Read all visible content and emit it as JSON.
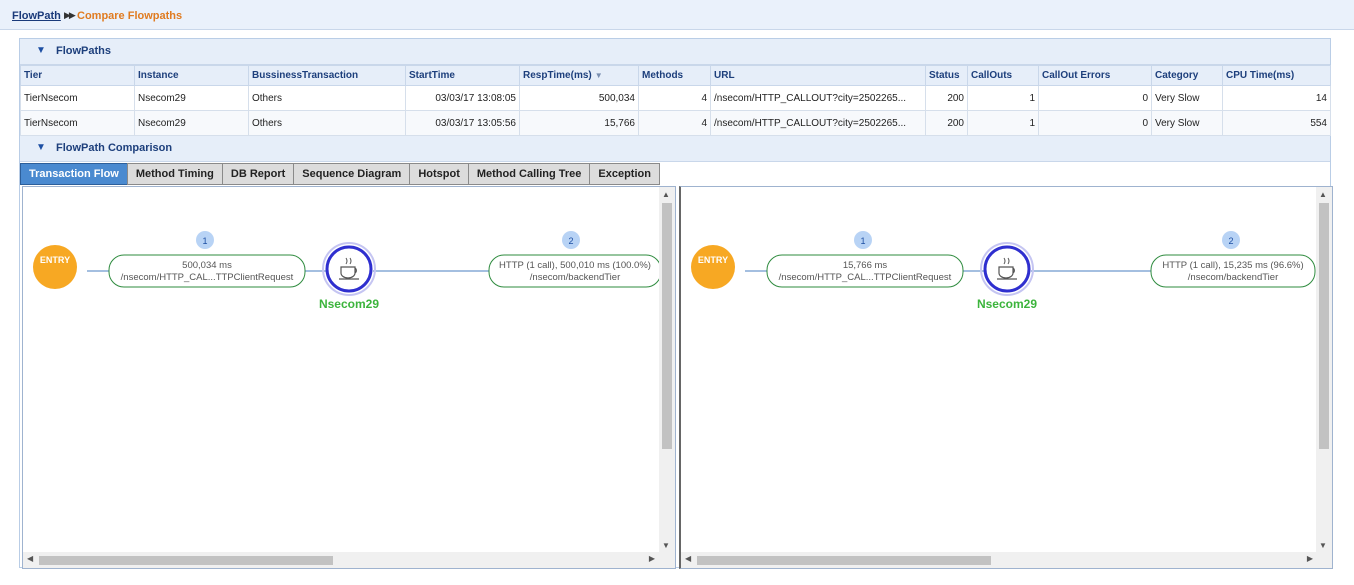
{
  "breadcrumb": {
    "root": "FlowPath",
    "separator": "▶▶",
    "current": "Compare Flowpaths"
  },
  "flowpaths_section": {
    "title": "FlowPaths"
  },
  "table": {
    "columns": [
      "Tier",
      "Instance",
      "BussinessTransaction",
      "StartTime",
      "RespTime(ms)",
      "Methods",
      "URL",
      "Status",
      "CallOuts",
      "CallOut Errors",
      "Category",
      "CPU Time(ms)"
    ],
    "rows": [
      [
        "TierNsecom",
        "Nsecom29",
        "Others",
        "03/03/17 13:08:05",
        "500,034",
        "4",
        "/nsecom/HTTP_CALLOUT?city=2502265...",
        "200",
        "1",
        "0",
        "Very Slow",
        "14"
      ],
      [
        "TierNsecom",
        "Nsecom29",
        "Others",
        "03/03/17 13:05:56",
        "15,766",
        "4",
        "/nsecom/HTTP_CALLOUT?city=2502265...",
        "200",
        "1",
        "0",
        "Very Slow",
        "554"
      ]
    ]
  },
  "comparison_section": {
    "title": "FlowPath Comparison"
  },
  "tabs": [
    "Transaction Flow",
    "Method Timing",
    "DB Report",
    "Sequence Diagram",
    "Hotspot",
    "Method Calling Tree",
    "Exception"
  ],
  "active_tab": "Transaction Flow",
  "colors": {
    "accent": "#4a8ad0",
    "entry": "#f7a823",
    "node_ring": "#2f2fcf",
    "node_label": "#3cb43c",
    "edge": "#2e8b3e",
    "crumb_current": "#e07b20"
  },
  "flows": [
    {
      "entry_label": "ENTRY",
      "step1_badge": "1",
      "step1_line1": "500,034 ms",
      "step1_line2": "/nsecom/HTTP_CAL...TTPClientRequest",
      "node_icon": "java-cup-icon",
      "node_label": "Nsecom29",
      "step2_badge": "2",
      "step2_line1": "HTTP (1 call), 500,010 ms (100.0%)",
      "step2_line2": "/nsecom/backendTier"
    },
    {
      "entry_label": "ENTRY",
      "step1_badge": "1",
      "step1_line1": "15,766 ms",
      "step1_line2": "/nsecom/HTTP_CAL...TTPClientRequest",
      "node_icon": "java-cup-icon",
      "node_label": "Nsecom29",
      "step2_badge": "2",
      "step2_line1": "HTTP (1 call), 15,235 ms (96.6%)",
      "step2_line2": "/nsecom/backendTier"
    }
  ]
}
